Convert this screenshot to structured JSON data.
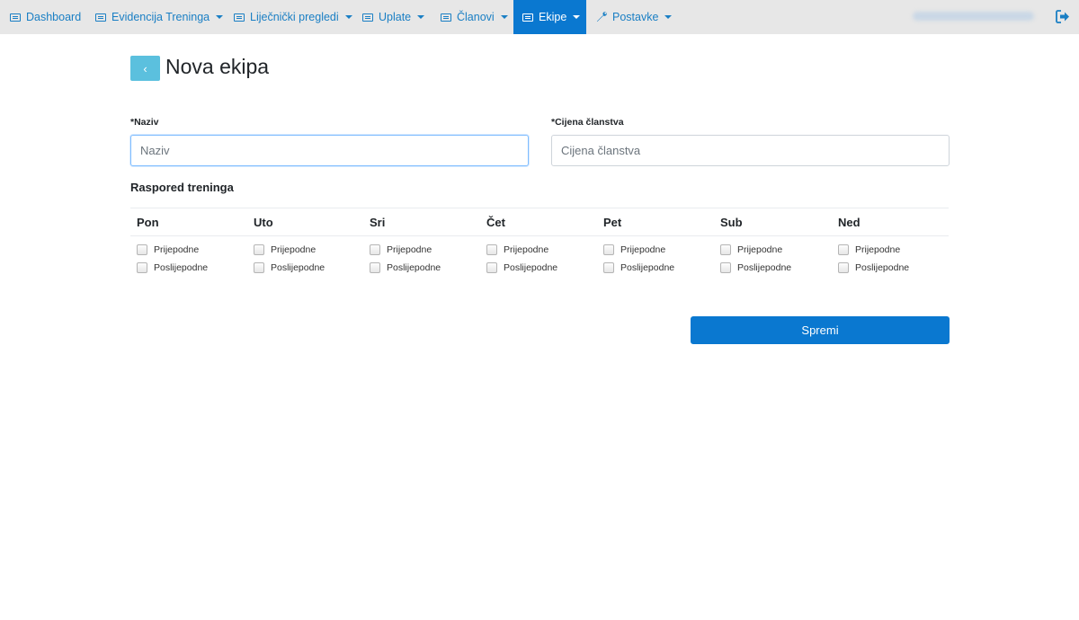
{
  "nav": {
    "items": [
      {
        "label": "Dashboard",
        "icon": "list-icon"
      },
      {
        "label": "Evidencija Treninga",
        "icon": "list-icon"
      },
      {
        "label": "Liječnički pregledi",
        "icon": "list-icon"
      },
      {
        "label": "Uplate",
        "icon": "list-icon"
      },
      {
        "label": "Članovi",
        "icon": "list-icon"
      },
      {
        "label": "Ekipe",
        "icon": "list-icon"
      },
      {
        "label": "Postavke",
        "icon": "wrench-icon"
      }
    ],
    "active_item": "Ekipe",
    "active_color": "#0a78d0",
    "bar_color": "#e7e7e7",
    "link_color": "#1a7fc4"
  },
  "header": {
    "back_label": "‹",
    "title": "Nova ekipa"
  },
  "form": {
    "name_label": "*Naziv",
    "name_placeholder": "Naziv",
    "price_label": "*Cijena članstva",
    "price_placeholder": "Cijena članstva"
  },
  "schedule": {
    "title": "Raspored treninga",
    "days": [
      "Pon",
      "Uto",
      "Sri",
      "Čet",
      "Pet",
      "Sub",
      "Ned"
    ],
    "options": [
      "Prijepodne",
      "Poslijepodne"
    ]
  },
  "actions": {
    "save_label": "Spremi",
    "save_color": "#0a78d0"
  }
}
